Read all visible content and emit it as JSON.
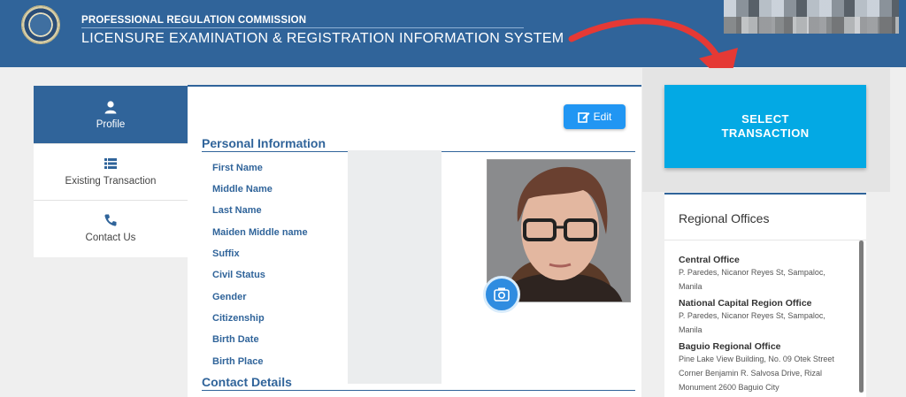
{
  "header": {
    "org_name": "PROFESSIONAL REGULATION COMMISSION",
    "system_name": "LICENSURE EXAMINATION & REGISTRATION INFORMATION SYSTEM"
  },
  "sidenav": {
    "items": [
      {
        "label": "Profile",
        "icon": "user-icon",
        "active": true
      },
      {
        "label": "Existing Transaction",
        "icon": "list-icon",
        "active": false
      },
      {
        "label": "Contact Us",
        "icon": "phone-icon",
        "active": false
      }
    ]
  },
  "main": {
    "edit_label": "Edit",
    "personal_title": "Personal Information",
    "fields": [
      "First Name",
      "Middle Name",
      "Last Name",
      "Maiden Middle name",
      "Suffix",
      "Civil Status",
      "Gender",
      "Citizenship",
      "Birth Date",
      "Birth Place"
    ],
    "contact_title": "Contact Details"
  },
  "transaction": {
    "select_label_line1": "SELECT",
    "select_label_line2": "TRANSACTION"
  },
  "regional": {
    "title": "Regional Offices",
    "offices": [
      {
        "name": "Central Office",
        "address_line1": "P. Paredes, Nicanor Reyes St, Sampaloc,",
        "address_line2": "Manila"
      },
      {
        "name": "National Capital Region Office",
        "address_line1": "P. Paredes, Nicanor Reyes St, Sampaloc,",
        "address_line2": "Manila"
      },
      {
        "name": "Baguio Regional Office",
        "address_line1": "Pine Lake View Building, No. 09 Otek Street",
        "address_line2": "Corner Benjamin R. Salvosa Drive, Rizal",
        "address_line3": "Monument 2600 Baguio City"
      }
    ]
  },
  "colors": {
    "header_blue": "#30649a",
    "accent_cyan": "#03a9e4",
    "edit_blue": "#2196f3",
    "arrow_red": "#e53935"
  }
}
